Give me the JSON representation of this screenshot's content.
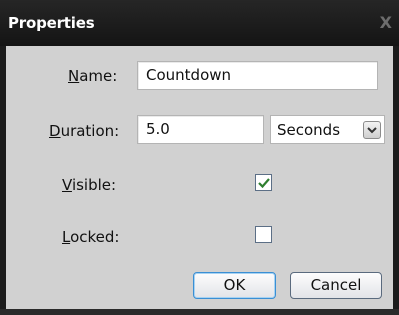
{
  "window": {
    "title": "Properties",
    "close_glyph": "X"
  },
  "fields": {
    "name": {
      "label_mnemonic": "N",
      "label_rest": "ame:",
      "value": "Countdown"
    },
    "duration": {
      "label_mnemonic": "D",
      "label_rest": "uration:",
      "value": "5.0",
      "unit": "Seconds"
    },
    "visible": {
      "label_mnemonic": "V",
      "label_rest": "isible:",
      "checked": true
    },
    "locked": {
      "label_mnemonic": "L",
      "label_rest": "ocked:",
      "checked": false
    }
  },
  "buttons": {
    "ok_label": "OK",
    "cancel_label": "Cancel"
  },
  "colors": {
    "panel": "#d1d1d1",
    "titlebar": "#1b1b1b",
    "checkmark": "#2f7f2f"
  },
  "icons": {
    "close": "close-icon",
    "dropdown": "chevron-down-icon",
    "check": "check-icon"
  }
}
